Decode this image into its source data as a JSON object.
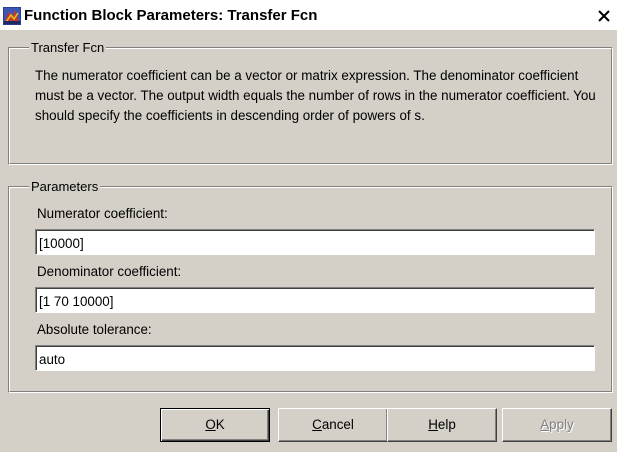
{
  "window": {
    "title": "Function Block Parameters: Transfer Fcn",
    "close_glyph": "×"
  },
  "block_group": {
    "legend": "Transfer Fcn",
    "description": "The numerator coefficient can be a vector or matrix expression. The denominator coefficient must be a vector. The output width equals the number of rows in the numerator coefficient. You should specify the coefficients in descending order of powers of s."
  },
  "parameters_group": {
    "legend": "Parameters",
    "numerator": {
      "label": "Numerator coefficient:",
      "value": "[10000]"
    },
    "denominator": {
      "label": "Denominator coefficient:",
      "value": "[1 70 10000]"
    },
    "tolerance": {
      "label": "Absolute tolerance:",
      "value": "auto"
    }
  },
  "buttons": {
    "ok": {
      "mnemonic": "O",
      "rest": "K",
      "enabled": true
    },
    "cancel": {
      "mnemonic": "C",
      "rest": "ancel",
      "enabled": true
    },
    "help": {
      "mnemonic": "H",
      "rest": "elp",
      "enabled": true
    },
    "apply": {
      "mnemonic": "A",
      "rest": "pply",
      "enabled": false
    }
  },
  "colors": {
    "window_bg": "#d4d0c8",
    "title_bg": "#ffffff",
    "field_bg": "#ffffff",
    "disabled_text": "#808080"
  },
  "icons": {
    "app": "simulink-block-icon",
    "close": "close-icon"
  }
}
